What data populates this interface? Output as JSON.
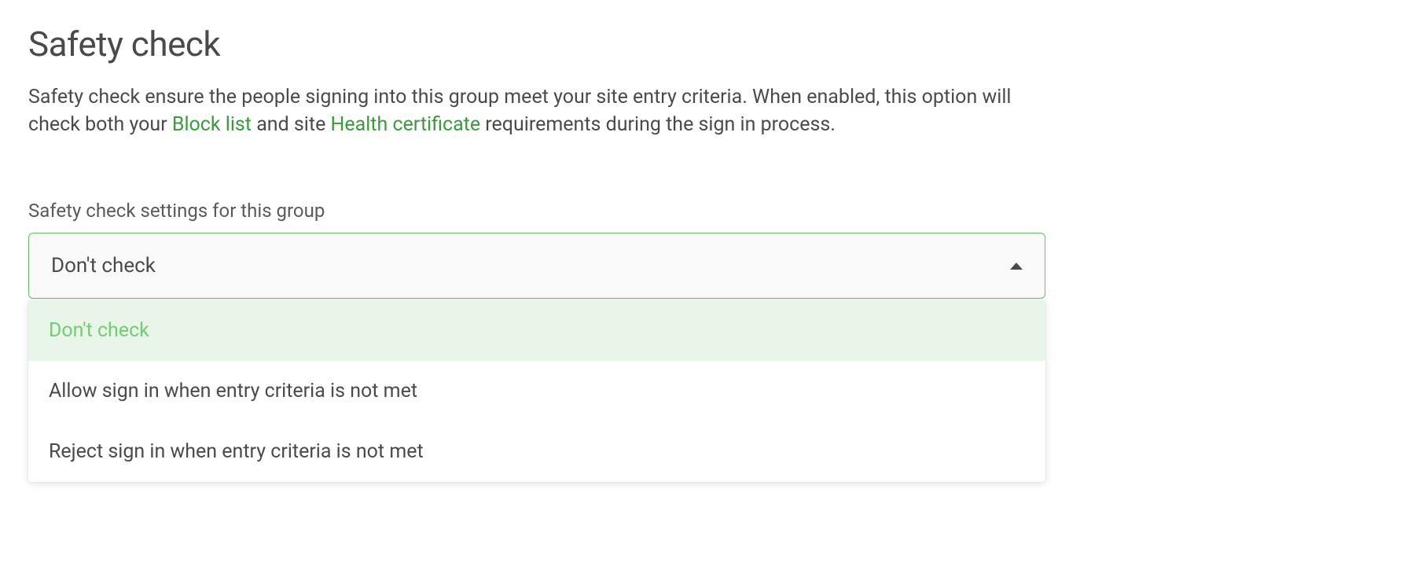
{
  "title": "Safety check",
  "description": {
    "pre": "Safety check ensure the people signing into this group meet your site entry criteria. When enabled, this option will check both your ",
    "link1": "Block list",
    "mid": " and site ",
    "link2": "Health certificate",
    "post": " requirements during the sign in process."
  },
  "field": {
    "label": "Safety check settings for this group",
    "selected": "Don't check",
    "options": [
      "Don't check",
      "Allow sign in when entry criteria is not met",
      "Reject sign in when entry criteria is not met"
    ]
  }
}
